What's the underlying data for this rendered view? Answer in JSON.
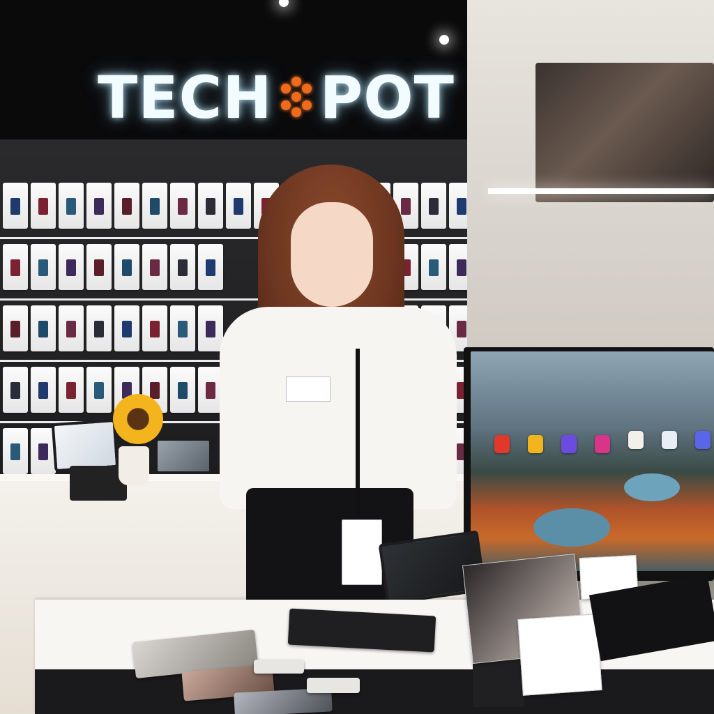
{
  "store_sign": {
    "text_left": "TECH",
    "text_right": "POT",
    "logo_icon": "orange-dot-cluster-icon",
    "glow_color": "#e9f8ff",
    "accent_color": "#f06a1c"
  },
  "scene": {
    "subject": "store-employee",
    "monitor_app_icons": [
      {
        "color": "#e0392b"
      },
      {
        "color": "#f2b51d"
      },
      {
        "color": "#6b4ce0"
      },
      {
        "color": "#d8348a"
      },
      {
        "color": "#f3f0ea"
      },
      {
        "color": "#e8eef6"
      },
      {
        "color": "#5a66e8"
      }
    ]
  }
}
